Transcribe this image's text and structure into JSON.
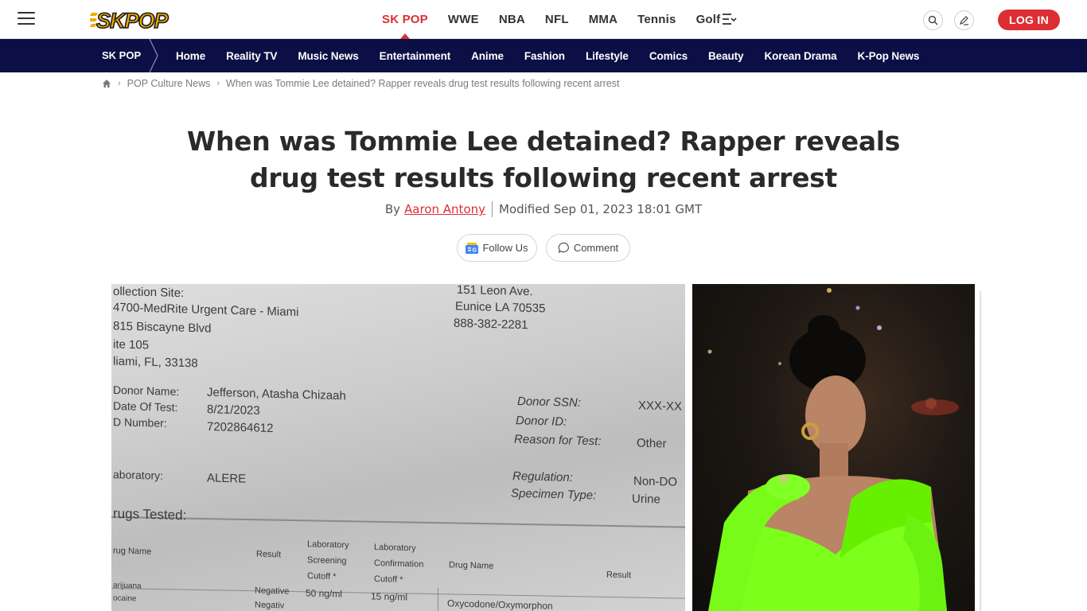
{
  "header": {
    "logo_text": "SK POP",
    "nav": [
      "SK POP",
      "WWE",
      "NBA",
      "NFL",
      "MMA",
      "Tennis",
      "Golf"
    ],
    "login_label": "LOG IN",
    "colors": {
      "accent": "#dc2e33",
      "catbar": "#0c0f45"
    }
  },
  "catbar": {
    "home": "SK POP",
    "items": [
      "Home",
      "Reality TV",
      "Music News",
      "Entertainment",
      "Anime",
      "Fashion",
      "Lifestyle",
      "Comics",
      "Beauty",
      "Korean Drama",
      "K-Pop News"
    ]
  },
  "breadcrumb": {
    "section": "POP Culture News",
    "current": "When was Tommie Lee detained? Rapper reveals drug test results following recent arrest"
  },
  "article": {
    "title_line1": "When was Tommie Lee detained? Rapper reveals",
    "title_line2": "drug test results following recent arrest",
    "by": "By",
    "author": "Aaron Antony",
    "modified": "Modified Sep 01, 2023 18:01 GMT",
    "follow_label": "Follow Us",
    "comment_label": "Comment"
  },
  "document_image": {
    "collection_site": "ollection Site:",
    "site_line1": "4700-MedRite Urgent Care - Miami",
    "site_line2": "815 Biscayne Blvd",
    "site_line3": "ite 105",
    "site_line4": "liami, FL, 33138",
    "addr_line1": "151 Leon Ave.",
    "addr_line2": "Eunice LA 70535",
    "addr_line3": "888-382-2281",
    "donor_name_label": "Donor Name:",
    "donor_name": "Jefferson, Atasha Chizaah",
    "date_label": "Date Of Test:",
    "date": "8/21/2023",
    "id_label": "D Number:",
    "id": "7202864612",
    "ssn_label": "Donor SSN:",
    "ssn": "XXX-XX",
    "donor_id_label": "Donor ID:",
    "reason_label": "Reason for Test:",
    "reason": "Other",
    "lab_label": "aboratory:",
    "lab": "ALERE",
    "regulation_label": "Regulation:",
    "regulation": "Non-DO",
    "specimen_label": "Specimen Type:",
    "specimen": "Urine",
    "drugs_tested": "rugs Tested:",
    "col_drug": "rug Name",
    "col_result": "Result",
    "col_screen": "Laboratory Screening Cutoff *",
    "col_confirm": "Laboratory Confirmation Cutoff *",
    "col_drug2": "Drug Name",
    "col_result2": "Result",
    "row1_drug": "arijuana",
    "row1_result": "Negative",
    "row1_screen": "50 ng/ml",
    "row1_confirm": "15 ng/ml",
    "row2_drug": "ocaine",
    "row2_result": "Negativ",
    "row2_drug2": "Oxycodone/Oxymorphon"
  }
}
